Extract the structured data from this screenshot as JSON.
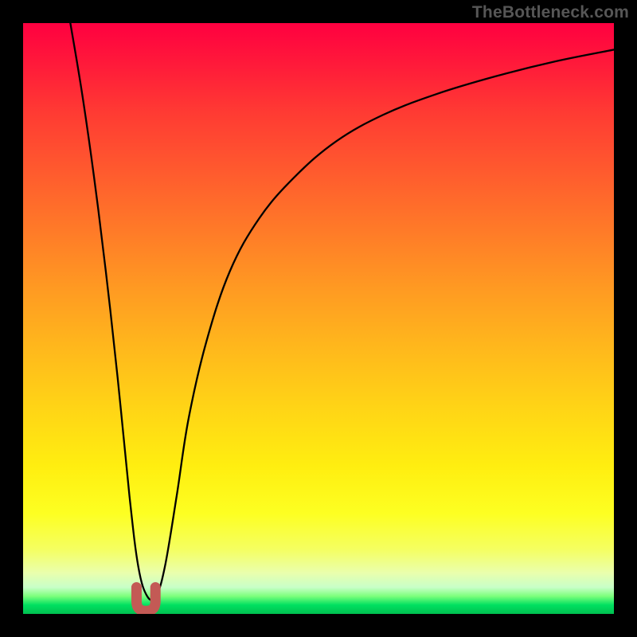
{
  "watermark": "TheBottleneck.com",
  "chart_data": {
    "type": "line",
    "title": "",
    "xlabel": "",
    "ylabel": "",
    "xlim": [
      0,
      100
    ],
    "ylim": [
      0,
      100
    ],
    "grid": false,
    "legend": false,
    "background_gradient": {
      "orientation": "vertical",
      "stops": [
        {
          "pos": 0,
          "color": "#ff0040"
        },
        {
          "pos": 35,
          "color": "#ff7a28"
        },
        {
          "pos": 75,
          "color": "#ffee10"
        },
        {
          "pos": 97,
          "color": "#7cff7c"
        },
        {
          "pos": 100,
          "color": "#00c050"
        }
      ]
    },
    "series": [
      {
        "name": "bottleneck-curve",
        "color": "#000000",
        "x": [
          8,
          10,
          12,
          14,
          16,
          18,
          19.5,
          21,
          22.5,
          24,
          26,
          28,
          31,
          35,
          40,
          46,
          53,
          61,
          70,
          80,
          90,
          100
        ],
        "y": [
          100,
          88,
          74,
          58,
          40,
          20,
          8,
          3,
          3,
          8,
          20,
          33,
          46,
          58,
          67,
          74,
          80,
          84.5,
          88,
          91,
          93.5,
          95.5
        ]
      }
    ],
    "marker": {
      "name": "bottom-u-marker",
      "color": "#c35a55",
      "x_range": [
        19.2,
        22.4
      ],
      "y_range": [
        0.5,
        4.5
      ]
    }
  }
}
